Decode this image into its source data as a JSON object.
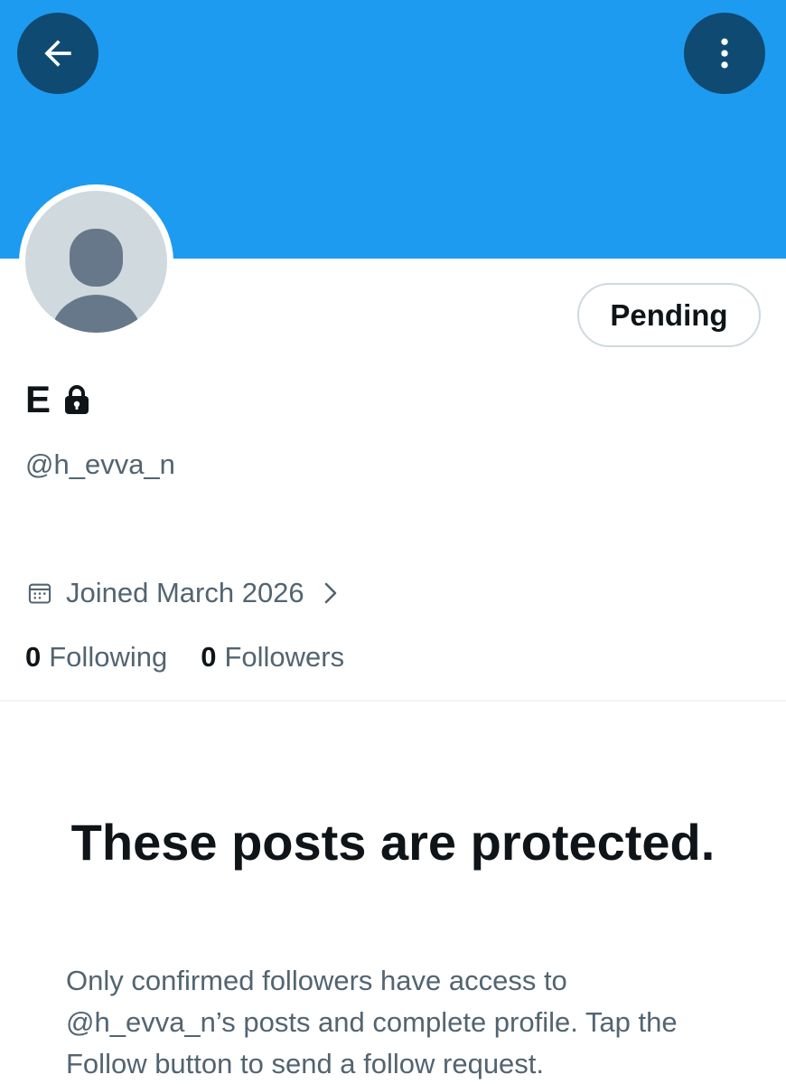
{
  "header": {
    "back_icon": "arrow-left-icon",
    "more_icon": "more-vertical-icon",
    "banner_color": "#1d9bf0",
    "button_color": "#0f4a73"
  },
  "profile": {
    "avatar_icon": "default-avatar-icon",
    "display_name": "E",
    "lock_icon": "lock-icon",
    "handle": "@h_evva_n",
    "follow_button_label": "Pending",
    "calendar_icon": "calendar-icon",
    "joined": "Joined March 2026",
    "chevron_icon": "chevron-right-icon",
    "following_count": "0",
    "following_label": "Following",
    "followers_count": "0",
    "followers_label": "Followers"
  },
  "protected": {
    "title": "These posts are protected.",
    "body": "Only confirmed followers have access to @h_evva_n’s posts and complete profile. Tap the Follow button to send a follow request."
  },
  "colors": {
    "text_primary": "#0f1419",
    "text_secondary": "#536471",
    "border": "#cfd9de"
  }
}
